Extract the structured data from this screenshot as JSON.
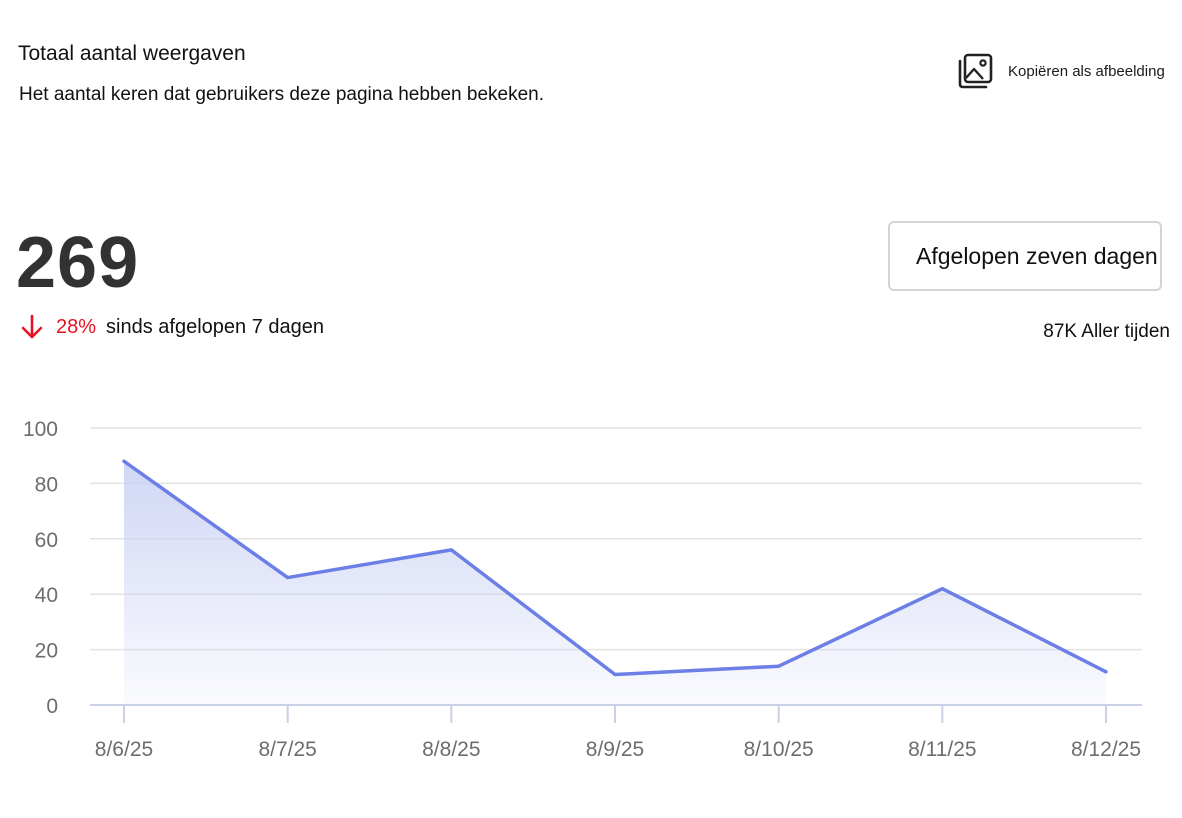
{
  "header": {
    "title": "Totaal aantal weergaven",
    "subtitle": "Het aantal keren dat gebruikers deze pagina hebben bekeken.",
    "copy_label": "Kopiëren als afbeelding",
    "copy_icon": "image-copy-icon"
  },
  "summary": {
    "total": "269",
    "change_pct": "28%",
    "change_text": "sinds afgelopen 7 dagen",
    "change_direction": "down",
    "change_color": "#e81123",
    "arrow_icon": "arrow-down-icon"
  },
  "range": {
    "selected": "Afgelopen zeven dagen",
    "all_time": "87K Aller tijden"
  },
  "chart_data": {
    "type": "area",
    "x": [
      "8/6/25",
      "8/7/25",
      "8/8/25",
      "8/9/25",
      "8/10/25",
      "8/11/25",
      "8/12/25"
    ],
    "series": [
      {
        "values": [
          88,
          46,
          56,
          11,
          14,
          42,
          12
        ]
      }
    ],
    "yticks": [
      0,
      20,
      40,
      60,
      80,
      100
    ],
    "ylim": [
      0,
      100
    ],
    "grid": true,
    "line_color": "#6b7fe6",
    "fill_color": "#c8cff3"
  }
}
